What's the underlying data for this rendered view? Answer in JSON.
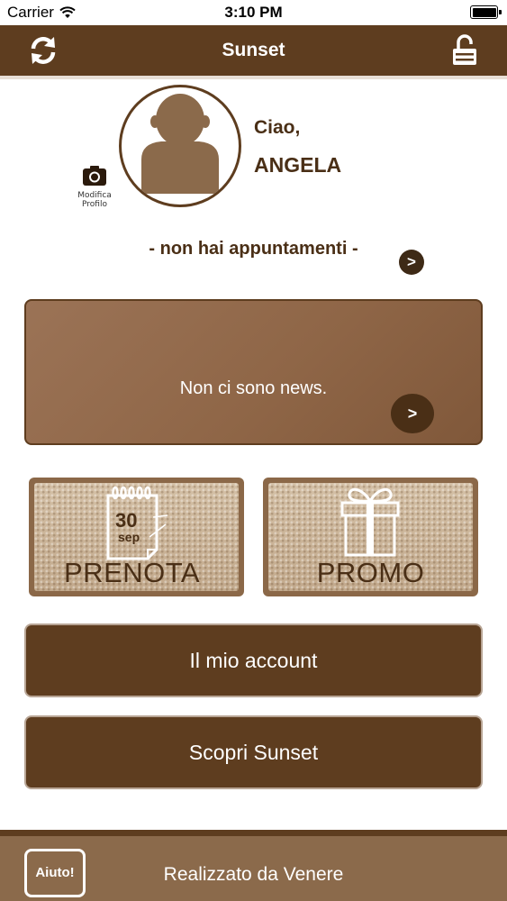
{
  "status_bar": {
    "carrier": "Carrier",
    "time": "3:10 PM"
  },
  "nav_bar": {
    "title": "Sunset",
    "left_icon": "refresh-icon",
    "right_icon": "lock-icon"
  },
  "profile": {
    "edit_label_line1": "Modifica",
    "edit_label_line2": "Profilo",
    "greeting": "Ciao,",
    "name": "ANGELA"
  },
  "appointments": {
    "text": "- non hai appuntamenti -",
    "arrow": ">"
  },
  "news": {
    "text": "Non ci sono news.",
    "arrow": ">"
  },
  "tiles": {
    "book": {
      "label": "PRENOTA",
      "day": "30",
      "month": "sep"
    },
    "promo": {
      "label": "PROMO"
    }
  },
  "buttons": {
    "account": "Il mio account",
    "discover": "Scopri Sunset"
  },
  "footer": {
    "help": "Aiuto!",
    "credit": "Realizzato da Venere"
  },
  "colors": {
    "brand_dark": "#5e3d1f",
    "brand_mid": "#8b6a4b",
    "news_bg": "#8f6647"
  }
}
